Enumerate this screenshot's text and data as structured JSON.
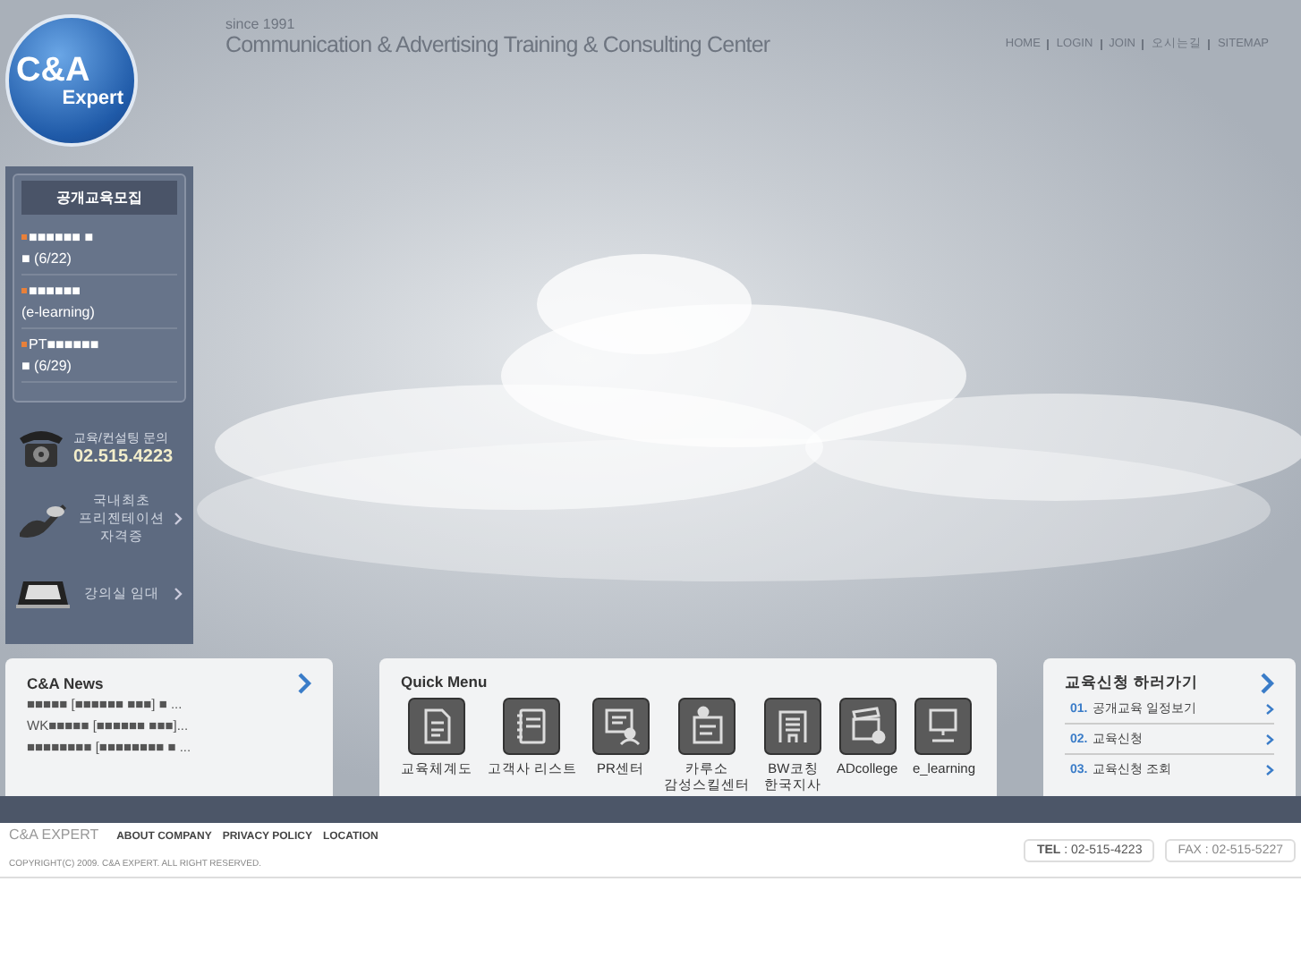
{
  "header": {
    "logo": {
      "line1": "C&A",
      "line2": "Expert"
    },
    "since": "since 1991",
    "tagline": "Communication & Advertising Training & Consulting Center",
    "nav": [
      "HOME",
      "LOGIN",
      "JOIN",
      "오시는길",
      "SITEMAP"
    ]
  },
  "sidebar": {
    "recruit": {
      "title": "공개교육모집",
      "items": [
        {
          "lines": [
            "■■■■■■ ■",
            "■ (6/22)"
          ]
        },
        {
          "lines": [
            "■■■■■■",
            "(e-learning)"
          ]
        },
        {
          "lines": [
            "PT■■■■■■",
            "■ (6/29)"
          ]
        }
      ]
    },
    "contact": {
      "label": "교육/컨설팅 문의",
      "phone": "02.515.4223"
    },
    "promo": {
      "lines": [
        "국내최초",
        "프리젠테이션",
        "자격증"
      ]
    },
    "rental": {
      "label": "강의실 임대"
    }
  },
  "news": {
    "title": "C&A News",
    "items": [
      "■■■■■ [■■■■■■ ■■■] ■ ...",
      "WK■■■■■ [■■■■■■ ■■■]...",
      "■■■■■■■■ [■■■■■■■■ ■ ..."
    ]
  },
  "quick_menu": {
    "title": "Quick Menu",
    "items": [
      {
        "kind": "document",
        "lines": [
          "교육체계도"
        ]
      },
      {
        "kind": "notebook",
        "lines": [
          "고객사 리스트"
        ]
      },
      {
        "kind": "presenter",
        "lines": [
          "PR센터"
        ]
      },
      {
        "kind": "clipboard",
        "lines": [
          "카루소",
          "감성스킬센터"
        ]
      },
      {
        "kind": "building",
        "lines": [
          "BW코칭",
          "한국지사"
        ]
      },
      {
        "kind": "clapper",
        "lines": [
          "ADcollege"
        ]
      },
      {
        "kind": "computer",
        "lines": [
          "e_learning"
        ]
      }
    ]
  },
  "apply": {
    "title": "교육신청 하러가기",
    "items": [
      {
        "number": "01.",
        "label": "공개교육 일정보기"
      },
      {
        "number": "02.",
        "label": "교육신청"
      },
      {
        "number": "03.",
        "label": "교육신청 조회"
      }
    ]
  },
  "footer": {
    "brand": "C&A EXPERT",
    "links": [
      "ABOUT COMPANY",
      "PRIVACY POLICY",
      "LOCATION"
    ],
    "copyright": "COPYRIGHT(C) 2009. C&A EXPERT. ALL RIGHT RESERVED.",
    "tel": {
      "label": "TEL",
      "value": ": 02-515-4223"
    },
    "fax": {
      "label": "FAX",
      "value": ": 02-515-5227"
    }
  }
}
